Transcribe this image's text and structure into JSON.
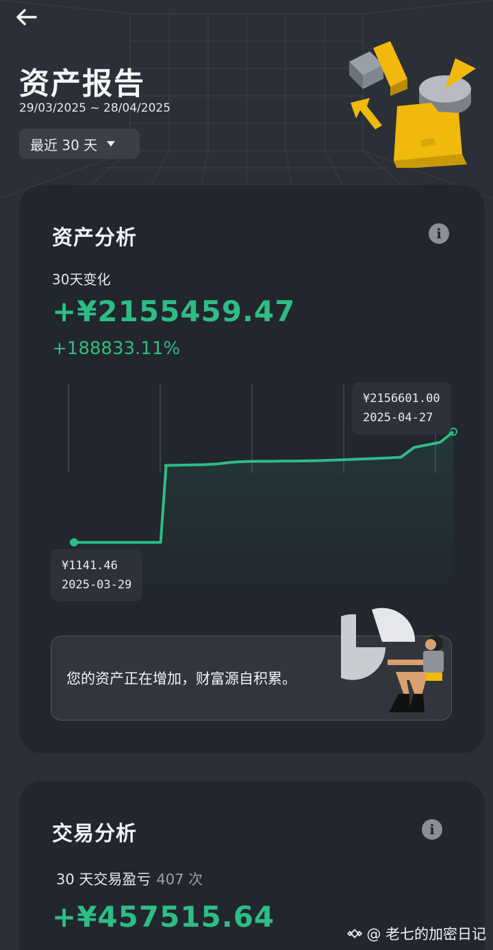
{
  "header": {
    "title": "资产报告",
    "date_range": "29/03/2025 ~ 28/04/2025",
    "range_select": "最近 30 天"
  },
  "asset_card": {
    "title": "资产分析",
    "change_label": "30天变化",
    "change_value": "+¥2155459.47",
    "change_pct": "+188833.11%",
    "start_tooltip": {
      "value": "¥1141.46",
      "date": "2025-03-29"
    },
    "end_tooltip": {
      "value": "¥2156601.00",
      "date": "2025-04-27"
    },
    "message": "您的资产正在增加，财富源自积累。"
  },
  "trade_card": {
    "title": "交易分析",
    "pnl_label": "30 天交易盈亏",
    "trade_count": "407 次",
    "pnl_value": "+¥457515.64"
  },
  "watermark": "@ 老七的加密日记",
  "colors": {
    "background": "#2b2f37",
    "card": "#22262d",
    "positive": "#2ebd85",
    "accent_yellow": "#f0b90b"
  },
  "icons": [
    "back-arrow-icon",
    "caret-down-icon",
    "info-icon",
    "binance-logo-icon"
  ],
  "chart_data": {
    "type": "line",
    "title": "",
    "xlabel": "",
    "ylabel": "",
    "x": [
      "2025-03-29",
      "2025-03-30",
      "2025-03-31",
      "2025-04-01",
      "2025-04-02",
      "2025-04-03",
      "2025-04-04",
      "2025-04-05",
      "2025-04-06",
      "2025-04-07",
      "2025-04-08",
      "2025-04-09",
      "2025-04-10",
      "2025-04-11",
      "2025-04-12",
      "2025-04-13",
      "2025-04-14",
      "2025-04-15",
      "2025-04-16",
      "2025-04-17",
      "2025-04-18",
      "2025-04-19",
      "2025-04-20",
      "2025-04-21",
      "2025-04-22",
      "2025-04-23",
      "2025-04-24",
      "2025-04-25",
      "2025-04-26",
      "2025-04-27"
    ],
    "series": [
      {
        "values": [
          1141.46,
          1141.46,
          1141.46,
          1141.46,
          1141.46,
          1141.46,
          1141.46,
          1500000,
          1505000,
          1510000,
          1515000,
          1530000,
          1560000,
          1575000,
          1580000,
          1580000,
          1585000,
          1585000,
          1590000,
          1595000,
          1605000,
          1615000,
          1625000,
          1635000,
          1645000,
          1660000,
          1850000,
          1900000,
          1950000,
          2156601.0
        ]
      }
    ],
    "ylim": [
      0,
      2300000
    ],
    "grid": false,
    "area_fill": true
  }
}
